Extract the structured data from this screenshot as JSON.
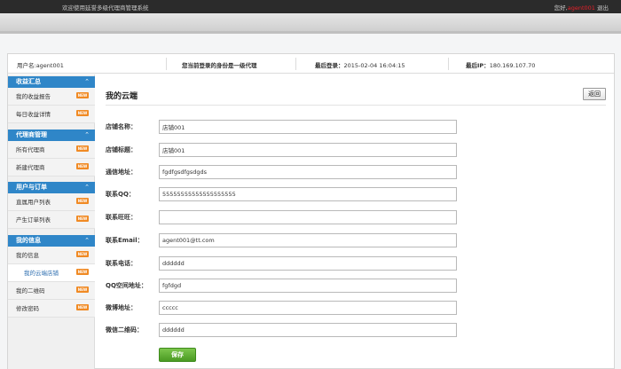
{
  "topbar": {
    "welcome": "欢迎使用延誉多级代理商管理系统",
    "greeting": "您好,",
    "username": "agent001",
    "logout": "退出"
  },
  "infobar": {
    "user_label": "用户名:",
    "user_value": "agent001",
    "role_text": "您当前登录的身份是一级代理",
    "last_login_label": "最后登录：",
    "last_login_value": "2015-02-04 16:04:15",
    "last_ip_label": "最后IP：",
    "last_ip_value": "180.169.107.70"
  },
  "sidebar": {
    "badge_text": "NEW",
    "groups": [
      {
        "label": "收益汇总",
        "items": [
          {
            "label": "我的收益报告"
          },
          {
            "label": "每日收益详情"
          }
        ]
      },
      {
        "label": "代理商管理",
        "items": [
          {
            "label": "所有代理商"
          },
          {
            "label": "新建代理商"
          }
        ]
      },
      {
        "label": "用户与订单",
        "items": [
          {
            "label": "直属用户列表"
          },
          {
            "label": "产生订单列表"
          }
        ]
      },
      {
        "label": "我的信息",
        "items": [
          {
            "label": "我的信息"
          },
          {
            "label": "我的云端店铺"
          },
          {
            "label": "我的二维码"
          },
          {
            "label": "修改密码"
          }
        ]
      }
    ]
  },
  "main": {
    "title": "我的云端",
    "back_label": "返回",
    "save_label": "保存",
    "fields": [
      {
        "label": "店铺名称：",
        "value": "店铺001"
      },
      {
        "label": "店铺标题：",
        "value": "店铺001"
      },
      {
        "label": "通信地址：",
        "value": "fgdfgsdfgsdgds"
      },
      {
        "label": "联系QQ：",
        "value": "55555555555555555555"
      },
      {
        "label": "联系旺旺：",
        "value": ""
      },
      {
        "label": "联系Email：",
        "value": "agent001@tt.com"
      },
      {
        "label": "联系电话：",
        "value": "dddddd"
      },
      {
        "label": "QQ空间地址：",
        "value": "fgfdgd"
      },
      {
        "label": "微博地址：",
        "value": "ccccc"
      },
      {
        "label": "微信二维码：",
        "value": "dddddd"
      }
    ]
  },
  "colors": {
    "topbar_bg": "#2b2b2b",
    "accent_blue": "#2f86c8",
    "username_red": "#e8202a",
    "save_green": "#5aae2e",
    "badge_orange": "#f08a24"
  }
}
